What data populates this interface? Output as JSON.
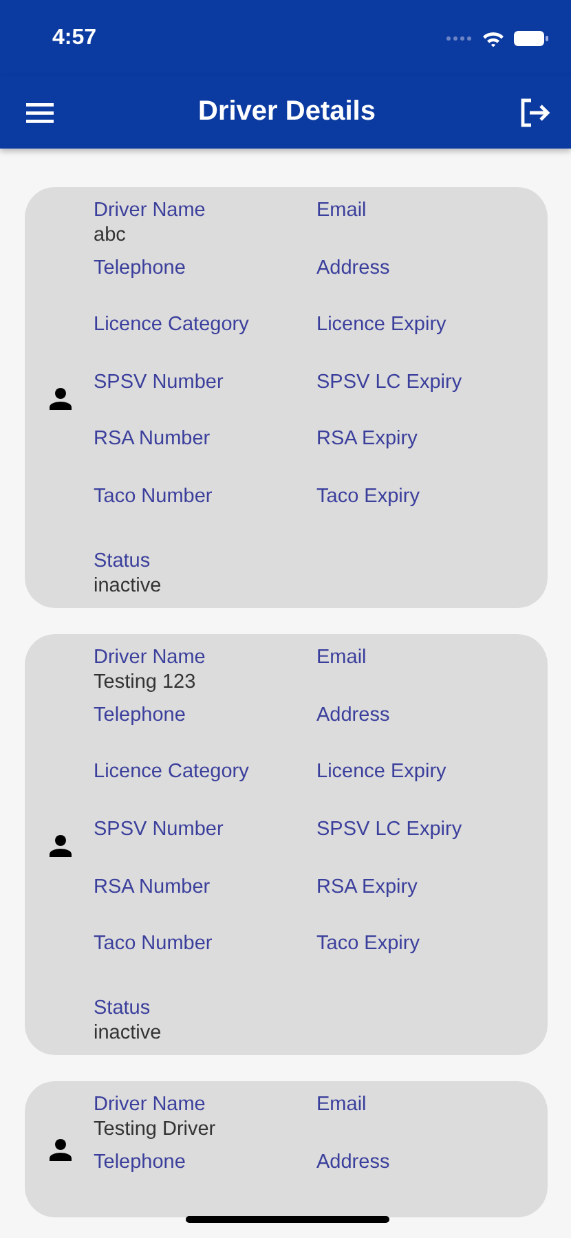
{
  "status_bar": {
    "time": "4:57"
  },
  "app_bar": {
    "title": "Driver Details"
  },
  "drivers": [
    {
      "fields": [
        {
          "label": "Driver Name",
          "value": "abc"
        },
        {
          "label": "Email"
        },
        {
          "label": "Telephone"
        },
        {
          "label": "Address"
        },
        {
          "label": "Licence Category"
        },
        {
          "label": "Licence Expiry"
        },
        {
          "label": "SPSV Number"
        },
        {
          "label": "SPSV LC Expiry"
        },
        {
          "label": "RSA Number"
        },
        {
          "label": "RSA Expiry"
        },
        {
          "label": "Taco Number"
        },
        {
          "label": "Taco Expiry"
        }
      ],
      "status": {
        "label": "Status",
        "value": "inactive"
      }
    },
    {
      "fields": [
        {
          "label": "Driver Name",
          "value": "Testing 123"
        },
        {
          "label": "Email"
        },
        {
          "label": "Telephone"
        },
        {
          "label": "Address"
        },
        {
          "label": "Licence Category"
        },
        {
          "label": "Licence Expiry"
        },
        {
          "label": "SPSV Number"
        },
        {
          "label": "SPSV LC Expiry"
        },
        {
          "label": "RSA Number"
        },
        {
          "label": "RSA Expiry"
        },
        {
          "label": "Taco Number"
        },
        {
          "label": "Taco Expiry"
        }
      ],
      "status": {
        "label": "Status",
        "value": "inactive"
      }
    },
    {
      "fields": [
        {
          "label": "Driver Name",
          "value": "Testing Driver"
        },
        {
          "label": "Email"
        },
        {
          "label": "Telephone"
        },
        {
          "label": "Address"
        }
      ]
    }
  ]
}
